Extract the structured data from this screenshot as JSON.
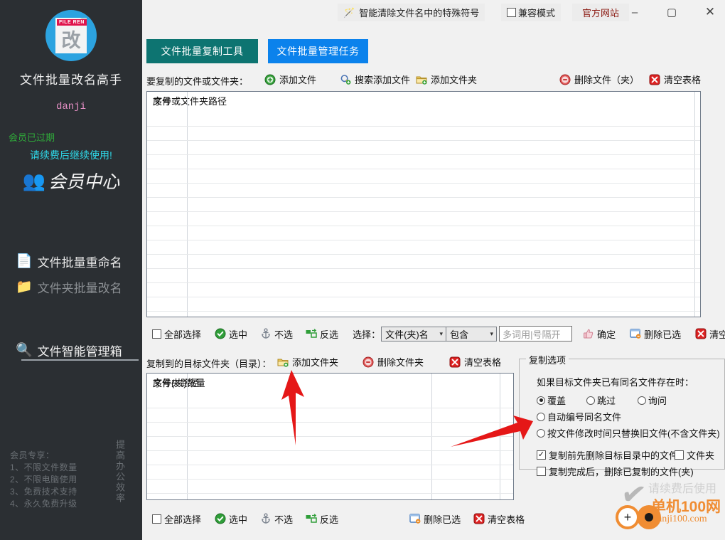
{
  "sidebar": {
    "logo": {
      "badge": "FILE REN",
      "glyph": "改",
      "icon": "app-logo-icon"
    },
    "app_title": "文件批量改名高手",
    "user_name": "danji",
    "vip_status": "会员已过期",
    "vip_renew": "请续费后继续使用!",
    "vip_center": "会员中心",
    "nav": [
      {
        "label": "文件批量重命名",
        "icon": "document-lines-icon"
      },
      {
        "label": "文件夹批量改名",
        "icon": "folder-icon"
      },
      {
        "label": "文件智能管理箱",
        "icon": "folder-search-icon"
      }
    ],
    "perks": [
      "会员专享：",
      "1、不限文件数量",
      "2、不限电脑使用",
      "3、免费技术支持",
      "4、永久免费升级"
    ],
    "slogan": "提高办公效率"
  },
  "titlebar": {
    "magic_tool": "智能清除文件名中的特殊符号",
    "compat_mode": "兼容模式",
    "official_site": "官方网站",
    "minimize": "–",
    "maximize": "▢",
    "close": "✕"
  },
  "tabs": [
    {
      "label": "文件批量复制工具",
      "active": false,
      "color": "#0d7471"
    },
    {
      "label": "文件批量管理任务",
      "active": true,
      "color": "#0b82ec"
    }
  ],
  "source_section": {
    "label": "要复制的文件或文件夹：",
    "actions": [
      {
        "label": "添加文件",
        "icon": "add-circle-icon"
      },
      {
        "label": "搜索添加文件",
        "icon": "search-add-icon"
      },
      {
        "label": "添加文件夹",
        "icon": "folder-add-icon"
      },
      {
        "label": "删除文件（夹）",
        "icon": "remove-circle-icon"
      },
      {
        "label": "清空表格",
        "icon": "clear-table-icon"
      }
    ],
    "table": {
      "columns": [
        "序号",
        "文件或文件夹路径",
        ""
      ],
      "rows": []
    }
  },
  "source_toolbar": {
    "select_all": "全部选择",
    "select_checked": "选中",
    "deselect": "不选",
    "invert": "反选",
    "select_label": "选择：",
    "field_select": "文件(夹)名",
    "match_select": "包含",
    "keyword_placeholder": "多词用|号隔开",
    "keyword_value": "",
    "confirm": "确定",
    "delete_selected": "删除已选",
    "clear_table": "清空表格"
  },
  "target_section": {
    "label": "复制到的目标文件夹（目录）：",
    "actions": [
      {
        "label": "添加文件夹",
        "icon": "folder-add-icon"
      },
      {
        "label": "删除文件夹",
        "icon": "remove-circle-icon"
      },
      {
        "label": "清空表格",
        "icon": "clear-table-icon"
      }
    ],
    "table": {
      "columns": [
        "序号",
        "文件夹路径",
        "文件(夹)数量",
        ""
      ],
      "rows": []
    }
  },
  "target_toolbar": {
    "select_all": "全部选择",
    "select_checked": "选中",
    "deselect": "不选",
    "invert": "反选",
    "delete_selected": "删除已选",
    "clear_table": "清空表格"
  },
  "options": {
    "group_title": "复制选项",
    "question": "如果目标文件夹已有同名文件存在时：",
    "radios": [
      {
        "label": "覆盖",
        "checked": true
      },
      {
        "label": "跳过",
        "checked": false
      },
      {
        "label": "询问",
        "checked": false
      },
      {
        "label": "自动编号同名文件",
        "checked": false
      },
      {
        "label": "按文件修改时间只替换旧文件(不含文件夹)",
        "checked": false
      }
    ],
    "checks": [
      {
        "label": "复制前先删除目标目录中的文件",
        "checked": true
      },
      {
        "label": "文件夹",
        "checked": false
      },
      {
        "label": "复制完成后，删除已复制的文件(夹)",
        "checked": false
      }
    ]
  },
  "watermark": {
    "text": "请续费后使用",
    "brand": "单机100网",
    "url": "danji100.com"
  }
}
